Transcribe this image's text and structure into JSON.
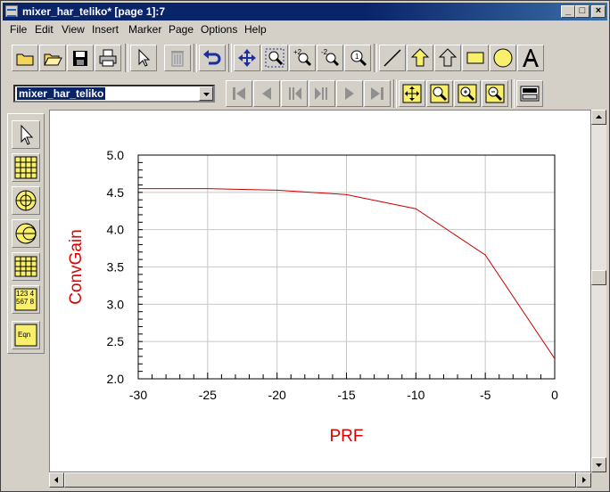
{
  "window": {
    "title": "mixer_har_teliko* [page 1]:7",
    "minimize": "_",
    "maximize": "□",
    "close": "×"
  },
  "menu": [
    {
      "label": "File"
    },
    {
      "label": "Edit"
    },
    {
      "label": "View"
    },
    {
      "label": "Insert"
    },
    {
      "label": "Marker"
    },
    {
      "label": "Page"
    },
    {
      "label": "Options"
    },
    {
      "label": "Help"
    }
  ],
  "dataset_select": {
    "value": "mixer_har_teliko"
  },
  "side_palette": {
    "list_label": "123 4 567 8",
    "eqn_label": "Eqn"
  },
  "chart_data": {
    "type": "line",
    "xlabel": "PRF",
    "ylabel": "ConvGain",
    "xlim": [
      -30,
      0
    ],
    "ylim": [
      2.0,
      5.0
    ],
    "xticks": [
      "-30",
      "-25",
      "-20",
      "-15",
      "-10",
      "-5",
      "0"
    ],
    "yticks": [
      "2.0",
      "2.5",
      "3.0",
      "3.5",
      "4.0",
      "4.5",
      "5.0"
    ],
    "grid": true,
    "line_color": "#cc0000",
    "label_color": "#dd0000",
    "series": [
      {
        "x": [
          -30,
          -25,
          -20,
          -15,
          -10,
          -5,
          0
        ],
        "values": [
          4.55,
          4.55,
          4.53,
          4.47,
          4.28,
          3.66,
          2.27
        ]
      }
    ]
  }
}
